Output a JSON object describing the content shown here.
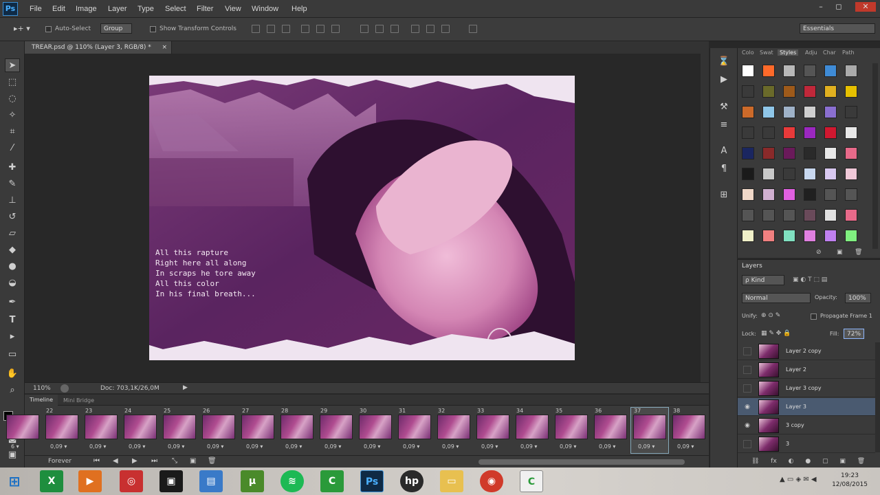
{
  "app": {
    "logo": "Ps"
  },
  "menu": [
    "File",
    "Edit",
    "Image",
    "Layer",
    "Type",
    "Select",
    "Filter",
    "View",
    "Window",
    "Help"
  ],
  "window_controls": [
    "–",
    "◻",
    "✕"
  ],
  "options_bar": {
    "auto_select_label": "Auto-Select",
    "auto_select_value": "Group",
    "show_transform_label": "Show Transform Controls",
    "workspace": "Essentials"
  },
  "document": {
    "tab_title": "TREAR.psd @ 110% (Layer 3, RGB/8) *",
    "lyrics": [
      "All this rapture",
      "Right here all along",
      "In scraps he tore away",
      "All this color",
      "In his final breath..."
    ]
  },
  "status": {
    "zoom": "110%",
    "doc": "Doc: 703,1K/26,0M"
  },
  "timeline_tabs": [
    "Timeline",
    "Mini Bridge"
  ],
  "frames": [
    {
      "n": "",
      "delay": "6 ▾"
    },
    {
      "n": "22",
      "delay": "0,09 ▾"
    },
    {
      "n": "23",
      "delay": "0,09 ▾"
    },
    {
      "n": "24",
      "delay": "0,09 ▾"
    },
    {
      "n": "25",
      "delay": "0,09 ▾"
    },
    {
      "n": "26",
      "delay": "0,09 ▾"
    },
    {
      "n": "27",
      "delay": "0,09 ▾"
    },
    {
      "n": "28",
      "delay": "0,09 ▾"
    },
    {
      "n": "29",
      "delay": "0,09 ▾"
    },
    {
      "n": "30",
      "delay": "0,09 ▾"
    },
    {
      "n": "31",
      "delay": "0,09 ▾"
    },
    {
      "n": "32",
      "delay": "0,09 ▾"
    },
    {
      "n": "33",
      "delay": "0,09 ▾"
    },
    {
      "n": "34",
      "delay": "0,09 ▾"
    },
    {
      "n": "35",
      "delay": "0,09 ▾"
    },
    {
      "n": "36",
      "delay": "0,09 ▾"
    },
    {
      "n": "37",
      "delay": "0,09 ▾"
    },
    {
      "n": "38",
      "delay": "0,09 ▾"
    }
  ],
  "timeline_controls": {
    "loop": "Forever"
  },
  "panel_tabs": [
    "Colo",
    "Swat",
    "Styles",
    "Adju",
    "Char",
    "Path"
  ],
  "swatches": [
    "#fff",
    "#ff6a2a",
    "#b8b8b8",
    "#555",
    "#3f8bd6",
    "#aaa",
    "#3a3a3a",
    "#6a6a2a",
    "#9e5a1a",
    "#c0283a",
    "#e0b020",
    "#e6c000",
    "#cc6a2a",
    "#8fc6e8",
    "#9fb2c8",
    "#cfcfcf",
    "#8a6fd0",
    "#3a3a3a",
    "#3a3a3a",
    "#3a3a3a",
    "#e83a3a",
    "#9b28c0",
    "#d01830",
    "#e8e8e8",
    "#1a2660",
    "#8a2a2a",
    "#6a1a5a",
    "#2a2a2a",
    "#e8e8e8",
    "#e86a8a",
    "#1a1a1a",
    "#c8c8c8",
    "#3a3a3a",
    "#c8d8f0",
    "#d8c8f0",
    "#f0c8d8",
    "#f0d8c8",
    "#d0b0d0",
    "#e060e0",
    "#202020",
    "#555",
    "#555",
    "#555",
    "#555",
    "#555",
    "#6a4a5a",
    "#e0e0e0",
    "#e86a8a",
    "#f0f0c8",
    "#f08080",
    "#80e0c0",
    "#e080e0",
    "#c080f0",
    "#80f080"
  ],
  "layers_panel": {
    "title": "Layers",
    "filter": "ρ Kind",
    "blend_mode": "Normal",
    "opacity_label": "Opacity:",
    "opacity": "100%",
    "unify_label": "Unify:",
    "propagate_label": "Propagate Frame 1",
    "lock_label": "Lock:",
    "fill_label": "Fill:",
    "fill": "72%",
    "layers": [
      {
        "name": "Layer 2 copy",
        "visible": false,
        "selected": false
      },
      {
        "name": "Layer 2",
        "visible": false,
        "selected": false
      },
      {
        "name": "Layer 3 copy",
        "visible": false,
        "selected": false
      },
      {
        "name": "Layer 3",
        "visible": true,
        "selected": true
      },
      {
        "name": "3 copy",
        "visible": true,
        "selected": false
      },
      {
        "name": "3",
        "visible": false,
        "selected": false
      }
    ]
  },
  "taskbar": {
    "clock_time": "19:23",
    "clock_date": "12/08/2015"
  }
}
